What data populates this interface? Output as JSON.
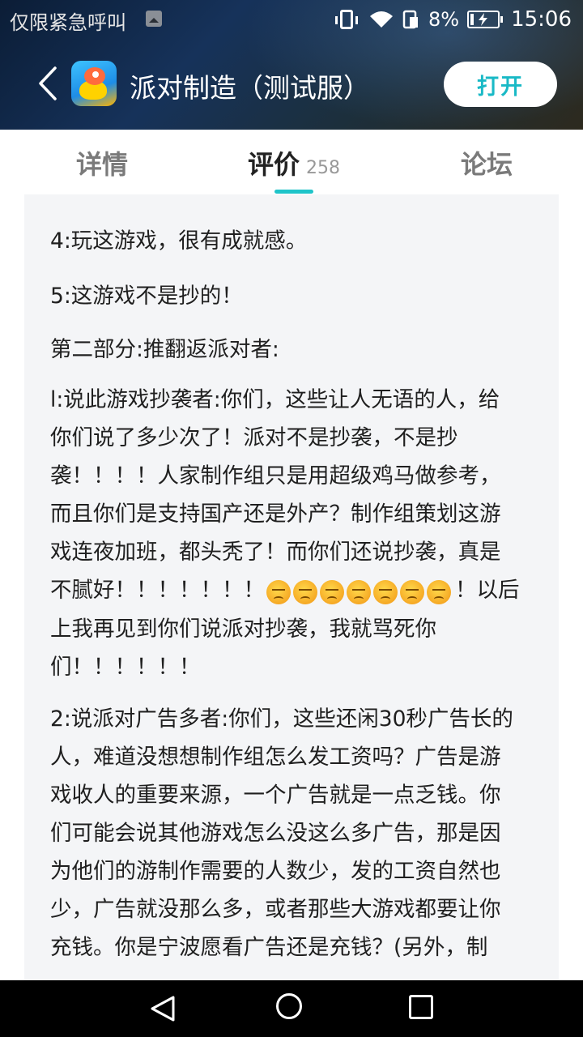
{
  "status_bar": {
    "carrier": "仅限紧急呼叫",
    "battery_percent": "8%",
    "time": "15:06",
    "icons": [
      "image-notification-icon",
      "vibrate-icon",
      "wifi-icon",
      "sim-icon",
      "battery-charging-icon"
    ]
  },
  "app_bar": {
    "title": "派对制造（测试服）",
    "open_label": "打开",
    "accent_color": "#19b9c6"
  },
  "tabs": [
    {
      "label": "详情",
      "active": false
    },
    {
      "label": "评价",
      "count": "258",
      "active": true
    },
    {
      "label": "论坛",
      "active": false
    }
  ],
  "review": {
    "p1": [
      "4:玩这游戏，很有成就感。"
    ],
    "p2": [
      "5:这游戏不是抄的！"
    ],
    "p3": [
      "第二部分:推翻返派对者:"
    ],
    "p4": [
      "l:说此游戏抄袭者:你们，这些让人无语的人，给",
      "你们说了多少次了！派对不是抄袭，不是抄",
      "袭！！！！人家制作组只是用超级鸡马做参考，",
      "而且你们是支持国产还是外产？制作组策划这游",
      "戏连夜加班，都头秃了！而你们还说抄袭，真是",
      "不腻好！！！！！！！",
      "！以后",
      "上我再见到你们说派对抄袭，我就骂死你",
      "们！！！！！！"
    ],
    "emoji_count": "7",
    "p5": [
      "2:说派对广告多者:你们，这些还闲30秒广告长的",
      "人，难道没想想制作组怎么发工资吗？广告是游",
      "戏收人的重要来源，一个广告就是一点乏钱。你",
      "们可能会说其他游戏怎么没这么多广告，那是因",
      "为他们的游制作需要的人数少，发的工资自然也",
      "少，广告就没那么多，或者那些大游戏都要让你",
      "充钱。你是宁波愿看广告还是充钱？(另外，制"
    ]
  },
  "navbar": {
    "buttons": [
      "back-triangle-icon",
      "home-circle-icon",
      "recent-square-icon"
    ]
  }
}
